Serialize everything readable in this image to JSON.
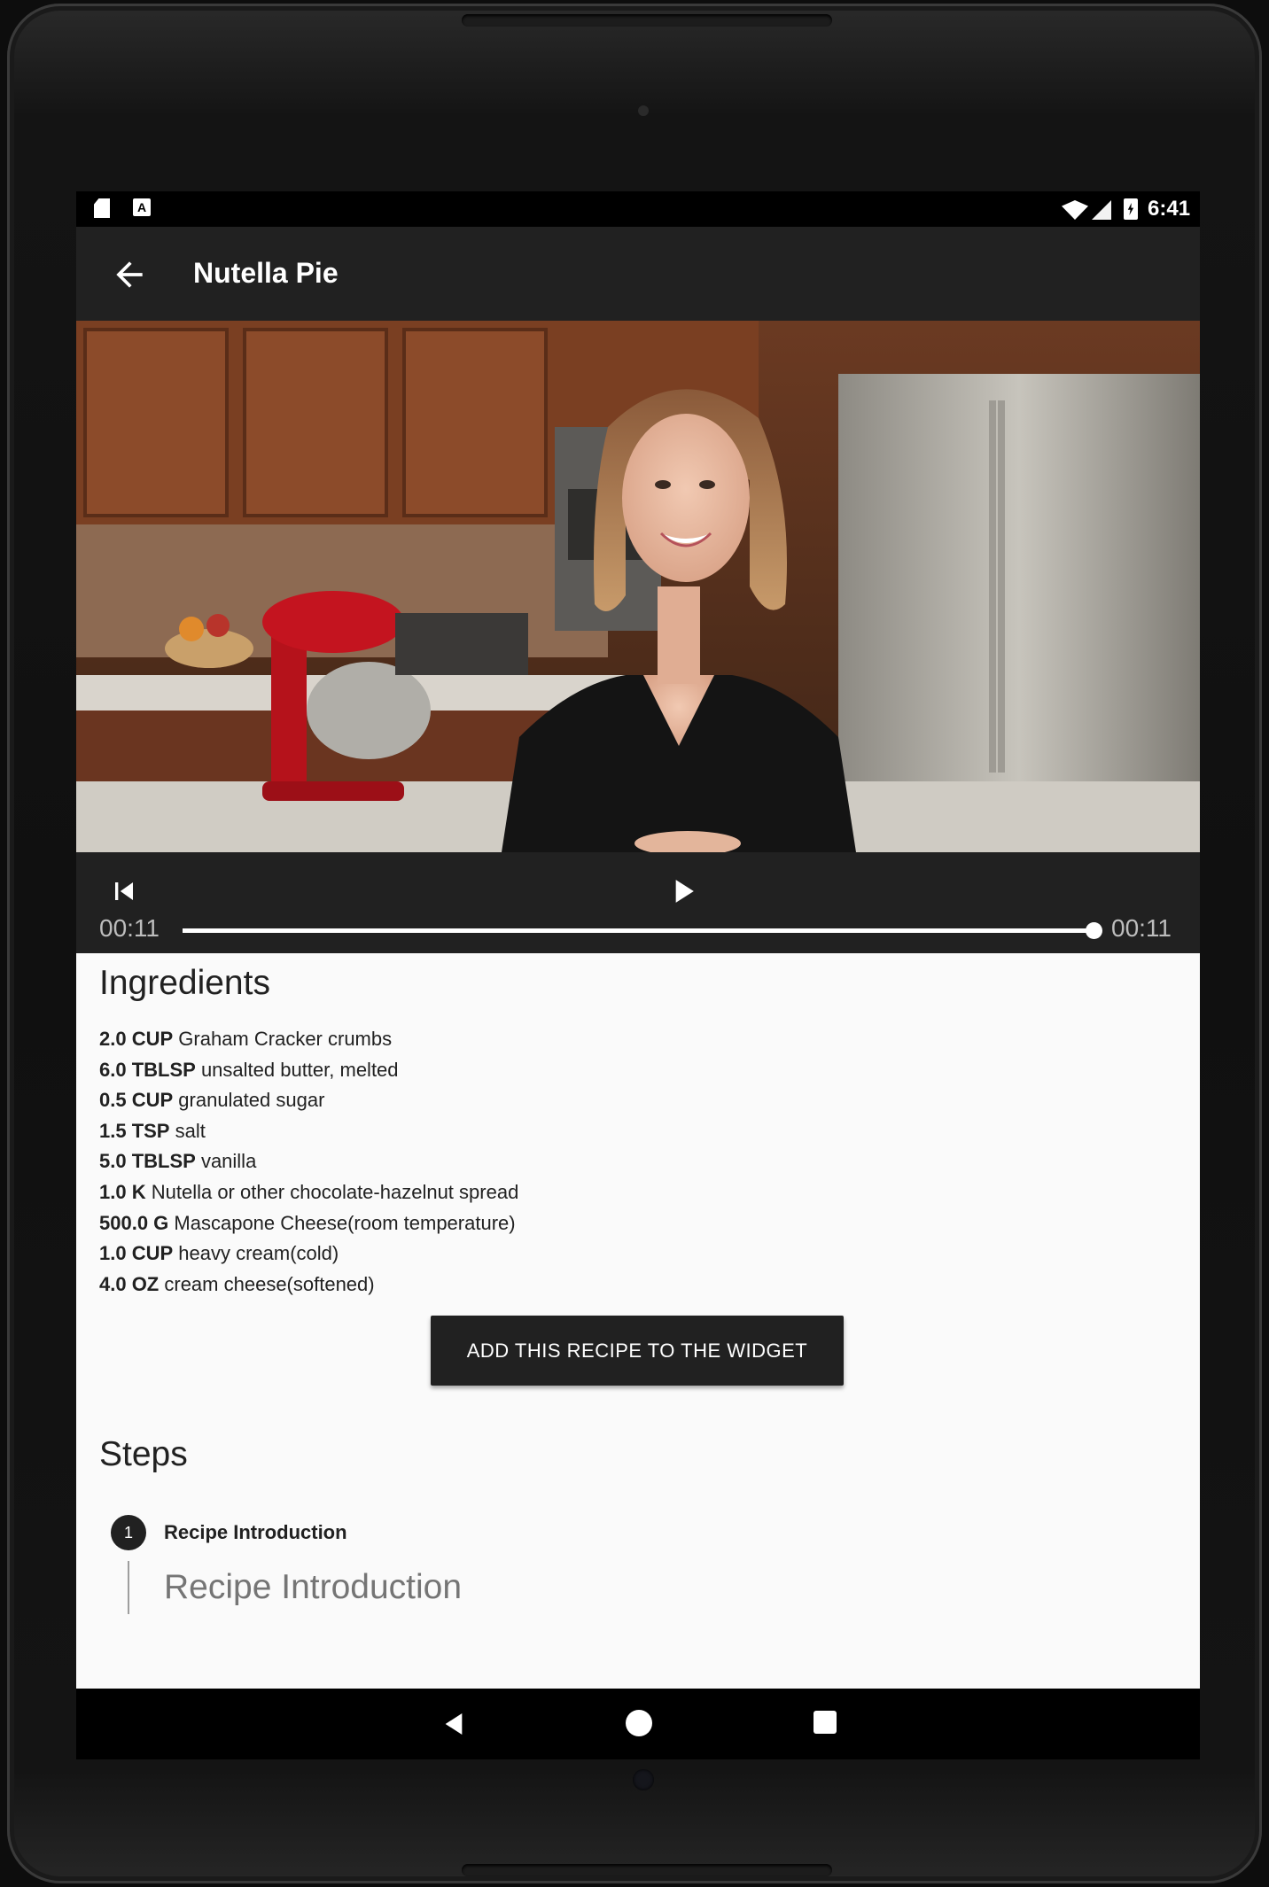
{
  "status_bar": {
    "time": "6:41",
    "icons": [
      "sd-card-icon",
      "a-notification-icon",
      "wifi-icon",
      "signal-icon",
      "battery-charging-icon"
    ]
  },
  "app_bar": {
    "title": "Nutella Pie",
    "back_icon": "arrow-back-icon"
  },
  "video": {
    "controls": {
      "previous_icon": "skip-previous-icon",
      "play_icon": "play-icon",
      "position": "00:11",
      "duration": "00:11",
      "progress": 1.0
    }
  },
  "ingredients": {
    "heading": "Ingredients",
    "items": [
      {
        "qty": "2.0 CUP",
        "name": "Graham Cracker crumbs"
      },
      {
        "qty": "6.0 TBLSP",
        "name": "unsalted butter, melted"
      },
      {
        "qty": "0.5 CUP",
        "name": "granulated sugar"
      },
      {
        "qty": "1.5 TSP",
        "name": "salt"
      },
      {
        "qty": "5.0 TBLSP",
        "name": "vanilla"
      },
      {
        "qty": "1.0 K",
        "name": "Nutella or other chocolate-hazelnut spread"
      },
      {
        "qty": "500.0 G",
        "name": "Mascapone Cheese(room temperature)"
      },
      {
        "qty": "1.0 CUP",
        "name": "heavy cream(cold)"
      },
      {
        "qty": "4.0 OZ",
        "name": "cream cheese(softened)"
      }
    ]
  },
  "widget_button": {
    "label": "ADD THIS RECIPE TO THE WIDGET"
  },
  "steps": {
    "heading": "Steps",
    "items": [
      {
        "number": "1",
        "title": "Recipe Introduction",
        "description": "Recipe Introduction"
      }
    ]
  },
  "nav_bar": {
    "icons": [
      "nav-back-icon",
      "nav-home-icon",
      "nav-recents-icon"
    ]
  }
}
